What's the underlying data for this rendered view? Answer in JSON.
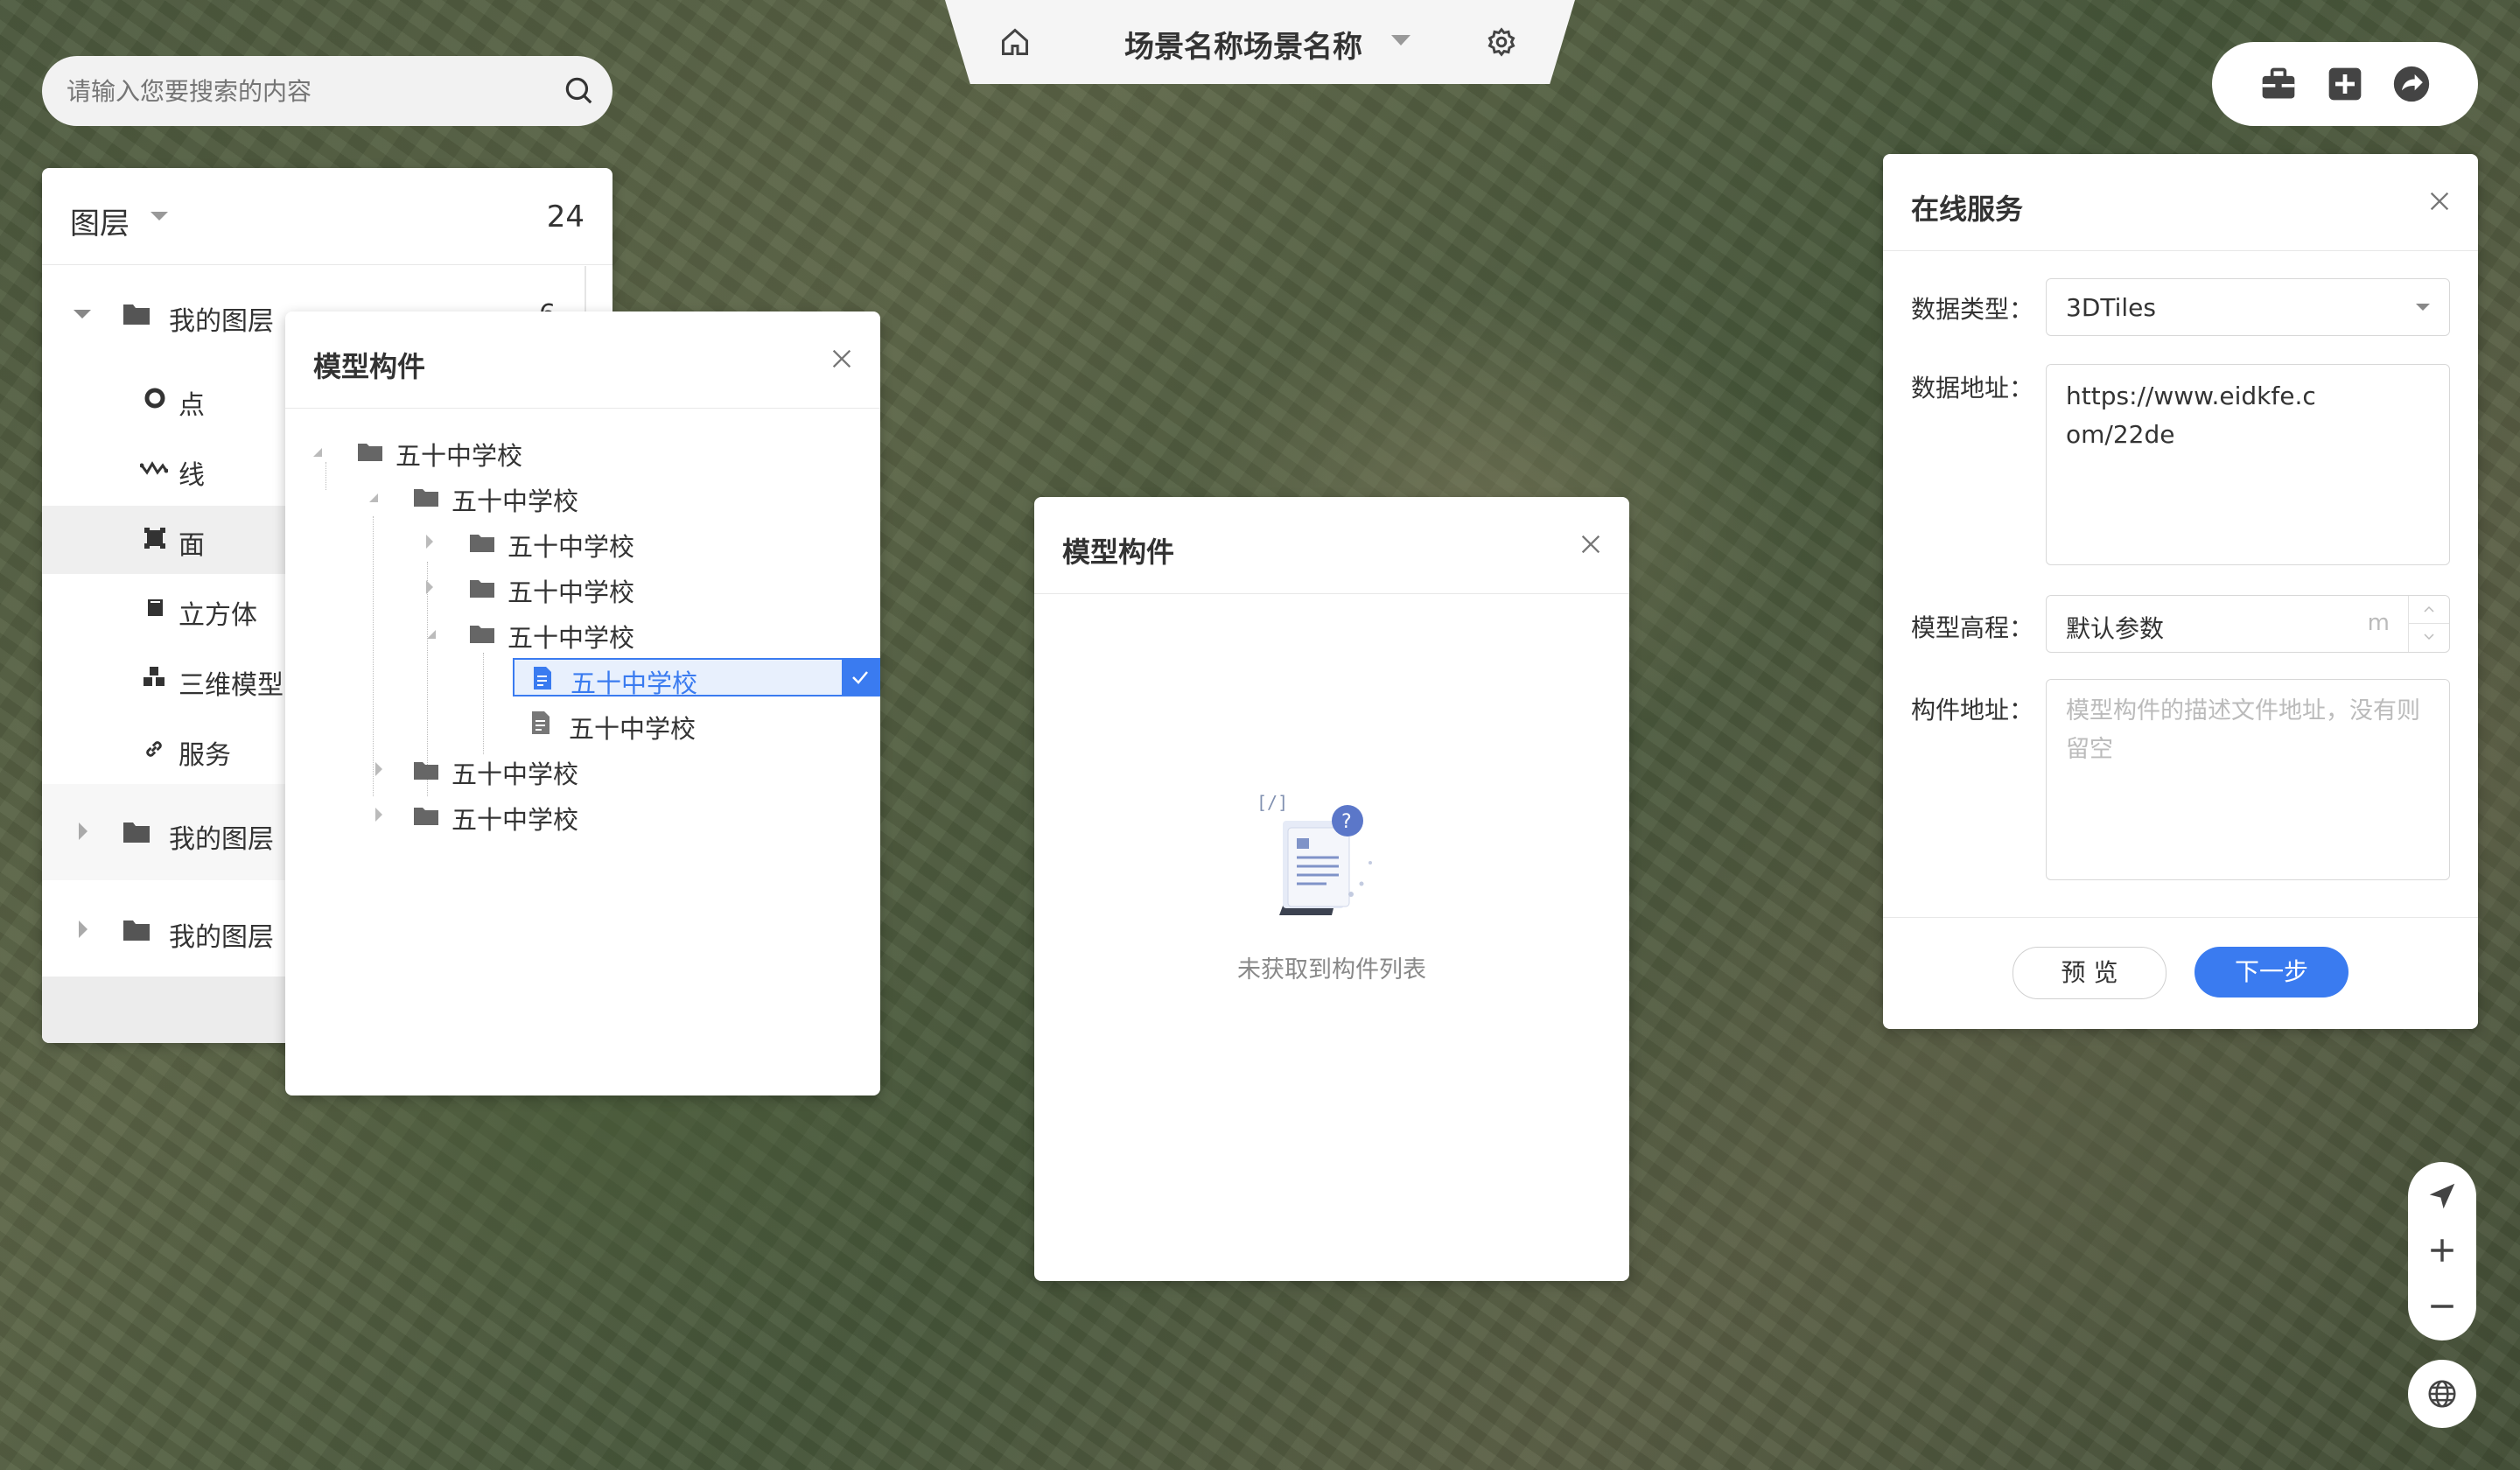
{
  "topbar": {
    "scene_title": "场景名称场景名称"
  },
  "search": {
    "placeholder": "请输入您要搜索的内容"
  },
  "layers": {
    "title": "图层",
    "count": "24",
    "group1": {
      "label": "我的图层",
      "count": "6"
    },
    "items": [
      {
        "label": "点",
        "icon": "point-icon"
      },
      {
        "label": "线",
        "icon": "line-icon"
      },
      {
        "label": "面",
        "icon": "polygon-icon"
      },
      {
        "label": "立方体",
        "icon": "cube-icon"
      },
      {
        "label": "三维模型",
        "icon": "model-icon"
      },
      {
        "label": "服务",
        "icon": "link-icon"
      }
    ],
    "group2": {
      "label": "我的图层"
    },
    "group3": {
      "label": "我的图层"
    }
  },
  "tree_modal": {
    "title": "模型构件",
    "nodes": [
      {
        "label": "五十中学校"
      },
      {
        "label": "五十中学校"
      },
      {
        "label": "五十中学校"
      },
      {
        "label": "五十中学校"
      },
      {
        "label": "五十中学校"
      },
      {
        "label": "五十中学校"
      },
      {
        "label": "五十中学校"
      },
      {
        "label": "五十中学校"
      },
      {
        "label": "五十中学校"
      }
    ]
  },
  "empty_modal": {
    "title": "模型构件",
    "empty_text": "未获取到构件列表"
  },
  "service_modal": {
    "title": "在线服务",
    "data_type_label": "数据类型：",
    "data_type_value": "3DTiles",
    "data_url_label": "数据地址：",
    "data_url_value": "https://www.eidkfe.com/22de",
    "height_label": "模型高程：",
    "height_value": "默认参数",
    "height_unit": "m",
    "component_label": "构件地址：",
    "component_placeholder": "模型构件的描述文件地址，没有则留空",
    "preview_btn": "预 览",
    "next_btn": "下一步"
  },
  "colors": {
    "accent": "#3a7bf0",
    "selected_bg": "#e8f0fd"
  }
}
